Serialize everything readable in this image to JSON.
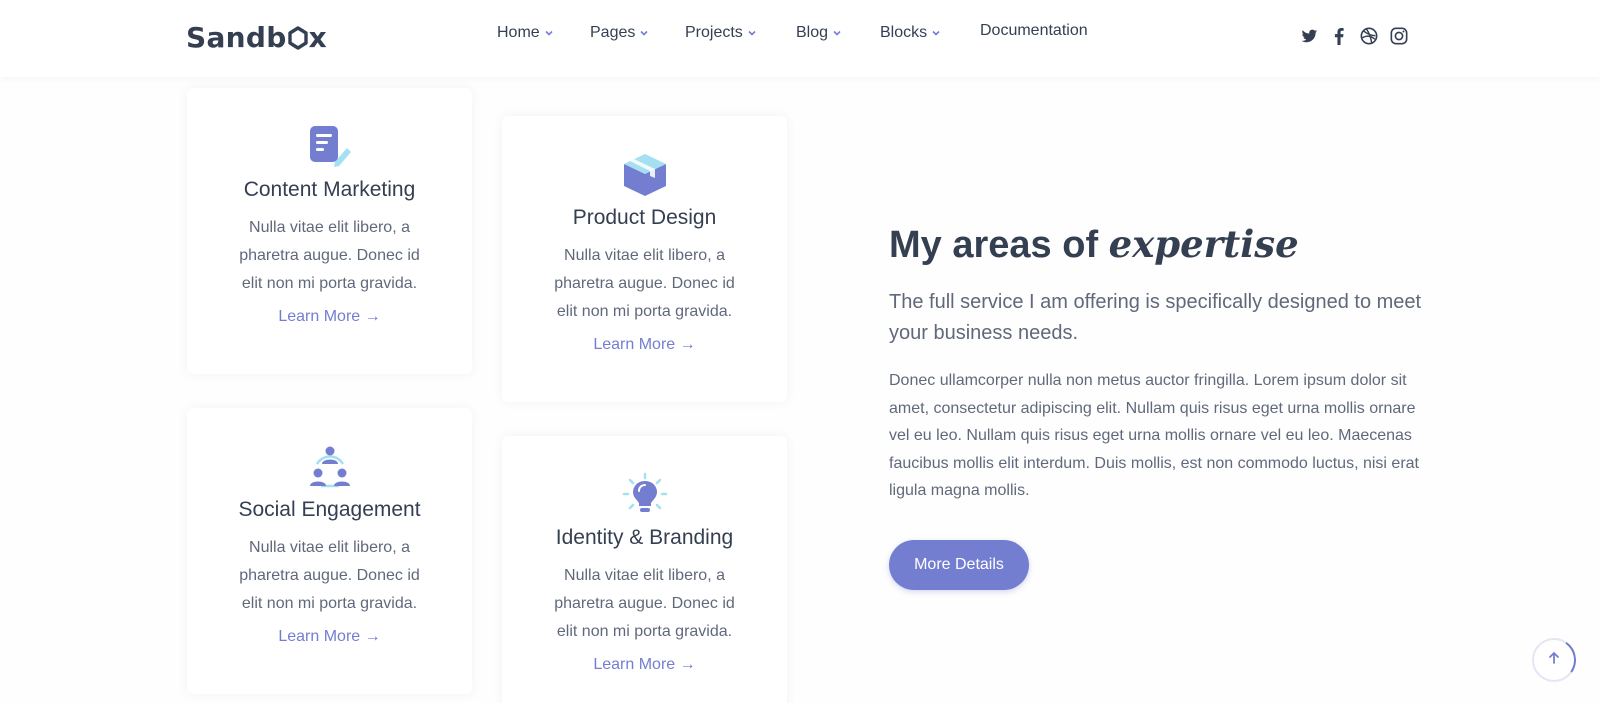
{
  "header": {
    "logo": "Sandbox",
    "nav": [
      {
        "label": "Home",
        "dropdown": true
      },
      {
        "label": "Pages",
        "dropdown": true
      },
      {
        "label": "Projects",
        "dropdown": true
      },
      {
        "label": "Blog",
        "dropdown": true
      },
      {
        "label": "Blocks",
        "dropdown": true
      },
      {
        "label": "Documentation",
        "dropdown": false
      }
    ],
    "socials": [
      "twitter-icon",
      "facebook-icon",
      "dribbble-icon",
      "instagram-icon"
    ]
  },
  "cards": [
    {
      "icon": "document-edit-icon",
      "title": "Content Marketing",
      "desc": "Nulla vitae elit libero, a pharetra augue. Donec id elit non mi porta gravida.",
      "link": "Learn More →"
    },
    {
      "icon": "box-icon",
      "title": "Product Design",
      "desc": "Nulla vitae elit libero, a pharetra augue. Donec id elit non mi porta gravida.",
      "link": "Learn More →"
    },
    {
      "icon": "team-network-icon",
      "title": "Social Engagement",
      "desc": "Nulla vitae elit libero, a pharetra augue. Donec id elit non mi porta gravida.",
      "link": "Learn More →"
    },
    {
      "icon": "lightbulb-icon",
      "title": "Identity & Branding",
      "desc": "Nulla vitae elit libero, a pharetra augue. Donec id elit non mi porta gravida.",
      "link": "Learn More →"
    }
  ],
  "expertise": {
    "heading_prefix": "My areas of",
    "heading_emphasis": "expertise",
    "lead": "The full service I am offering is specifically designed to meet your business needs.",
    "body": "Donec ullamcorper nulla non metus auctor fringilla. Lorem ipsum dolor sit amet, consectetur adipiscing elit. Nullam quis risus eget urna mollis ornare vel eu leo. Nullam quis risus eget urna mollis ornare vel eu leo. Maecenas faucibus mollis elit interdum. Duis mollis, est non commodo luctus, nisi erat ligula magna mollis.",
    "button": "More Details"
  },
  "scroll_top_icon": "arrow-up-icon",
  "colors": {
    "primary": "#747ed1",
    "text_dark": "#343f52",
    "text_muted": "#60697b",
    "accent_light": "#a4e0f1"
  }
}
